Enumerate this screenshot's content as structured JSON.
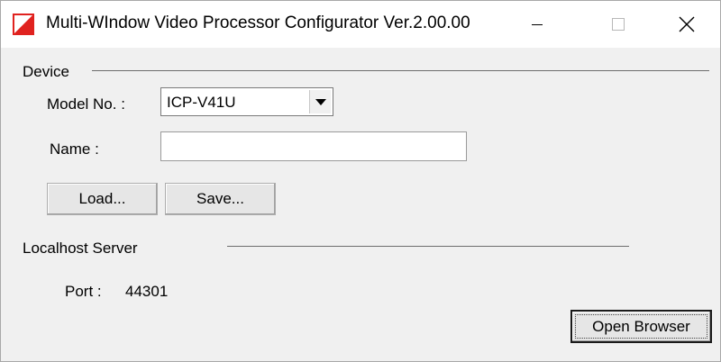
{
  "window": {
    "title": "Multi-WIndow Video Processor Configurator Ver.2.00.00",
    "icon": "app-logo-icon",
    "accent_color": "#e0221f"
  },
  "device": {
    "group_title": "Device",
    "model_label": "Model No. :",
    "model_value": "ICP-V41U",
    "name_label": "Name :",
    "name_value": "",
    "load_button": "Load...",
    "save_button": "Save..."
  },
  "server": {
    "group_title": "Localhost Server",
    "port_label": "Port :",
    "port_value": "44301",
    "open_browser_button": "Open Browser"
  }
}
